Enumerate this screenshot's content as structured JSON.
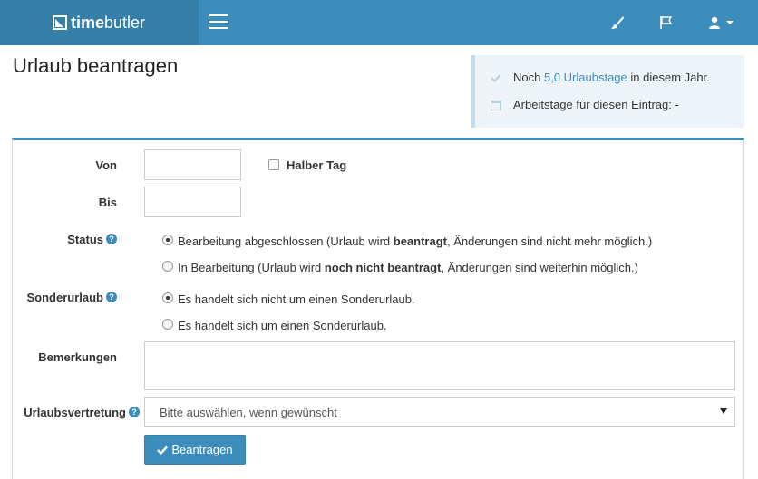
{
  "navbar": {
    "brand_bold": "time",
    "brand_regular": "butler",
    "icons": [
      "menu-icon",
      "paint-brush-icon",
      "flag-icon",
      "user-icon",
      "caret-down-icon"
    ]
  },
  "page": {
    "title": "Urlaub beantragen"
  },
  "info": {
    "line1_prefix": "Noch",
    "line1_link": "5,0 Urlaubstage",
    "line1_suffix": "in diesem Jahr.",
    "line2": "Arbeitstage für diesen Eintrag: -"
  },
  "form": {
    "von_label": "Von",
    "von_value": "",
    "halber_tag_label": "Halber Tag",
    "bis_label": "Bis",
    "bis_value": "",
    "status_label": "Status",
    "status_opt1_a": "Bearbeitung abgeschlossen (Urlaub wird ",
    "status_opt1_b": "beantragt",
    "status_opt1_c": ", Änderungen sind nicht mehr möglich.)",
    "status_opt2_a": "In Bearbeitung (Urlaub wird ",
    "status_opt2_b": "noch nicht beantragt",
    "status_opt2_c": ", Änderungen sind weiterhin möglich.)",
    "sonder_label": "Sonderurlaub",
    "sonder_opt1": "Es handelt sich nicht um einen Sonderurlaub.",
    "sonder_opt2": "Es handelt sich um einen Sonderurlaub.",
    "bemerkungen_label": "Bemerkungen",
    "bemerkungen_value": "",
    "vertretung_label": "Urlaubsvertretung",
    "vertretung_selected": "Bitte auswählen, wenn gewünscht",
    "submit_label": "Beantragen",
    "help_glyph": "?"
  },
  "colors": {
    "navbar": "#3c8dbc",
    "brand_bg": "#367fa9",
    "info_bg": "#edf4fa",
    "accent": "#3c8dbc"
  }
}
